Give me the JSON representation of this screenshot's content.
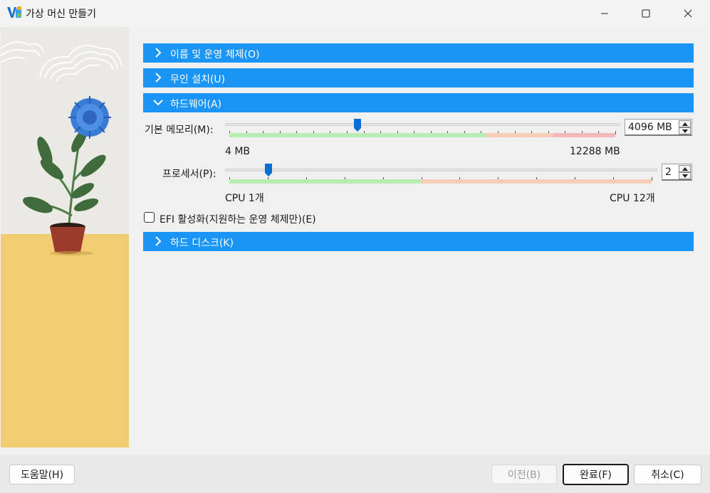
{
  "window": {
    "title": "가상 머신 만들기"
  },
  "sections": {
    "name_os": "이름 및 운영 체제(O)",
    "unattended": "무인 설치(U)",
    "hardware": "하드웨어(A)",
    "hard_disk": "하드 디스크(K)"
  },
  "hardware": {
    "memory": {
      "label": "기본 메모리(M):",
      "value": "4096 MB",
      "min_label": "4 MB",
      "max_label": "12288 MB",
      "min": 4,
      "max": 12288,
      "current": 4096
    },
    "processor": {
      "label": "프로세서(P):",
      "value": "2",
      "min_label": "CPU 1개",
      "max_label": "CPU 12개",
      "min": 1,
      "max": 12,
      "current": 2
    },
    "efi": {
      "label": "EFI 활성화(지원하는 운영 체제만)(E)",
      "checked": false
    }
  },
  "footer": {
    "help": "도움말(H)",
    "back": "이전(B)",
    "finish": "완료(F)",
    "cancel": "취소(C)"
  },
  "colors": {
    "section_bar": "#1a94f5",
    "slider_green": "#b9ecb3",
    "slider_orange": "#f6cdb7",
    "slider_red": "#f4b8b8",
    "thumb": "#0a6fd4",
    "side_wall": "#ebe9e4",
    "side_floor": "#f1cd70"
  },
  "icons": {
    "app": "virtualbox-icon",
    "minimize": "minimize-icon",
    "maximize": "maximize-icon",
    "close": "close-icon",
    "expand": "chevron-right-icon",
    "collapse": "chevron-down-icon"
  }
}
